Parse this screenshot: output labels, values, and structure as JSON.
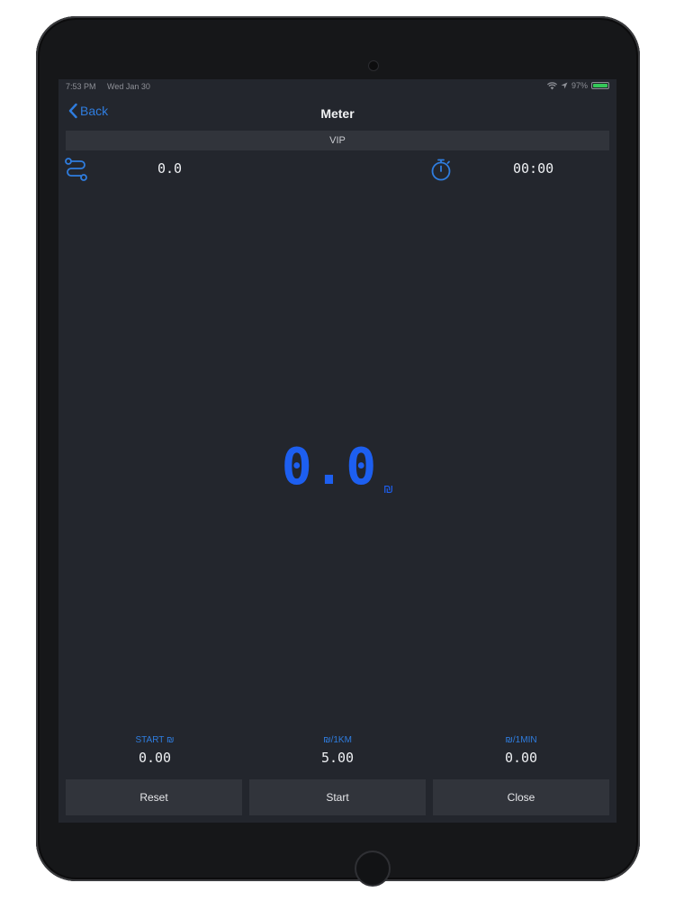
{
  "status_bar": {
    "time": "7:53 PM",
    "date": "Wed Jan 30",
    "battery_text": "97%"
  },
  "nav": {
    "back_label": "Back",
    "title": "Meter"
  },
  "tier": {
    "label": "VIP"
  },
  "trip": {
    "distance": "0.0",
    "elapsed": "00:00"
  },
  "fare": {
    "total": "0.0",
    "currency_symbol": "₪"
  },
  "rates": {
    "start": {
      "label": "START ₪",
      "value": "0.00"
    },
    "per_km": {
      "label": "₪/1KM",
      "value": "5.00"
    },
    "per_min": {
      "label": "₪/1MIN",
      "value": "0.00"
    }
  },
  "actions": {
    "reset_label": "Reset",
    "start_label": "Start",
    "close_label": "Close"
  },
  "colors": {
    "accent": "#2f7ddf",
    "fare_blue": "#1d5ff0",
    "screen_bg": "#23262d",
    "panel_bg": "#31343b",
    "battery_green": "#35c759"
  },
  "icons": {
    "back": "chevron-left-icon",
    "distance": "route-icon",
    "timer": "stopwatch-icon",
    "wifi": "wifi-icon",
    "battery": "battery-icon"
  }
}
